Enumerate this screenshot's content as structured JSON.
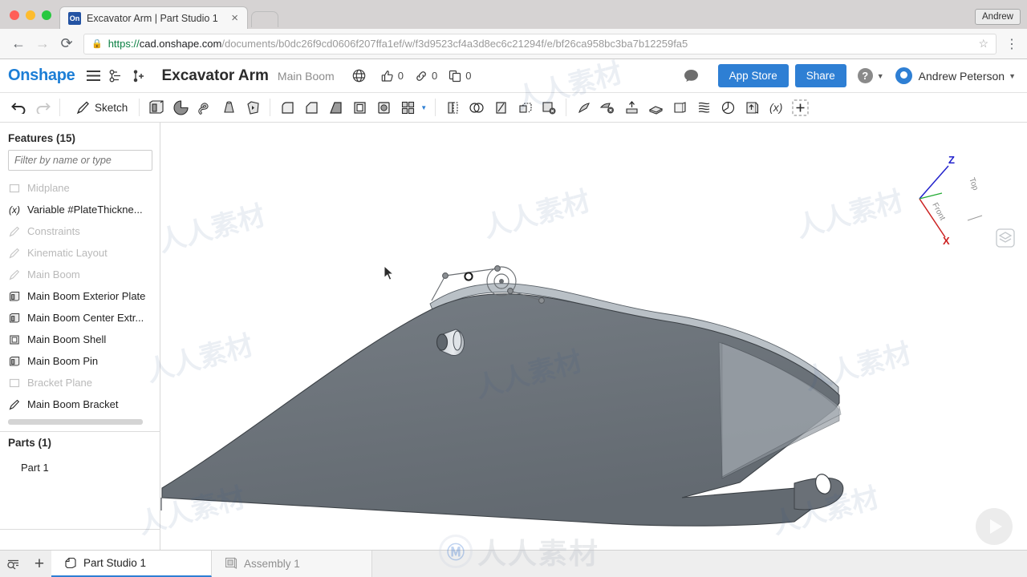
{
  "browser": {
    "tab_title": "Excavator Arm | Part Studio 1",
    "favicon_label": "On",
    "close_label": "×",
    "back_icon": "←",
    "forward_icon": "→",
    "reload_icon": "⟳",
    "lock_icon": "🔒",
    "url_scheme": "https://",
    "url_host": "cad.onshape.com",
    "url_path": "/documents/b0dc26f9cd0606f207ffa1ef/w/f3d9523cf4a3d8ec6c21294f/e/bf26ca958bc3ba7b12259fa5",
    "star_icon": "☆",
    "menu_icon": "⋮",
    "profile_label": "Andrew"
  },
  "header": {
    "logo": "Onshape",
    "document_title": "Excavator Arm",
    "workspace": "Main Boom",
    "visibility_icon": "globe-icon",
    "likes": "0",
    "links": "0",
    "copies": "0",
    "comment_icon": "comment-icon",
    "app_store_label": "App Store",
    "share_label": "Share",
    "help_label": "?",
    "user_name": "Andrew Peterson",
    "accent_color": "#2e7fd4"
  },
  "toolbar": {
    "undo": "undo-icon",
    "redo": "redo-icon",
    "sketch_label": "Sketch",
    "tools": [
      "extrude-icon",
      "revolve-icon",
      "sweep-icon",
      "loft-icon",
      "thicken-icon",
      "fillet-icon",
      "chamfer-icon",
      "draft-icon",
      "shell-icon",
      "hole-icon",
      "linear-pattern-icon",
      "mirror-icon",
      "boolean-icon",
      "split-icon",
      "transform-icon",
      "delete-face-icon",
      "move-face-icon",
      "replace-face-icon",
      "delete-part-icon",
      "plane-icon",
      "curve-icon",
      "helix-icon",
      "import-icon",
      "variable-icon",
      "custom-feature-icon"
    ]
  },
  "features_panel": {
    "header": "Features (15)",
    "filter_placeholder": "Filter by name or type",
    "items": [
      {
        "label": "Midplane",
        "icon": "plane-icon",
        "state": "suppressed"
      },
      {
        "label": "Variable #PlateThickne...",
        "icon": "variable-icon",
        "state": "active"
      },
      {
        "label": "Constraints",
        "icon": "sketch-icon",
        "state": "suppressed"
      },
      {
        "label": "Kinematic Layout",
        "icon": "sketch-icon",
        "state": "suppressed"
      },
      {
        "label": "Main Boom",
        "icon": "sketch-icon",
        "state": "suppressed"
      },
      {
        "label": "Main Boom Exterior Plate",
        "icon": "extrude-icon",
        "state": "active"
      },
      {
        "label": "Main Boom Center Extr...",
        "icon": "extrude-icon",
        "state": "active"
      },
      {
        "label": "Main Boom Shell",
        "icon": "shell-icon",
        "state": "active"
      },
      {
        "label": "Main Boom Pin",
        "icon": "extrude-icon",
        "state": "active"
      },
      {
        "label": "Bracket Plane",
        "icon": "plane-icon",
        "state": "suppressed"
      },
      {
        "label": "Main Boom Bracket",
        "icon": "sketch-icon",
        "state": "active"
      }
    ]
  },
  "parts_panel": {
    "header": "Parts (1)",
    "items": [
      {
        "label": "Part 1"
      }
    ]
  },
  "viewcube": {
    "axis_z": "Z",
    "axis_x": "X",
    "face_top": "Top",
    "face_front": "Front",
    "color_z": "#2222cc",
    "color_x": "#cc2222",
    "color_y": "#22aa33"
  },
  "model": {
    "body_color": "#6b7177",
    "top_face_color": "#9aa1a8",
    "edge_color": "#3c4146",
    "name": "excavator-main-boom"
  },
  "bottom_tabs": {
    "search_icon": "element-search-icon",
    "add_icon": "+",
    "tabs": [
      {
        "label": "Part Studio 1",
        "icon": "part-studio-icon",
        "active": true
      },
      {
        "label": "Assembly 1",
        "icon": "assembly-icon",
        "active": false
      }
    ]
  },
  "watermark": {
    "text": "人人素材",
    "logo_glyph": "Ⓜ",
    "play_icon": "play-icon"
  }
}
